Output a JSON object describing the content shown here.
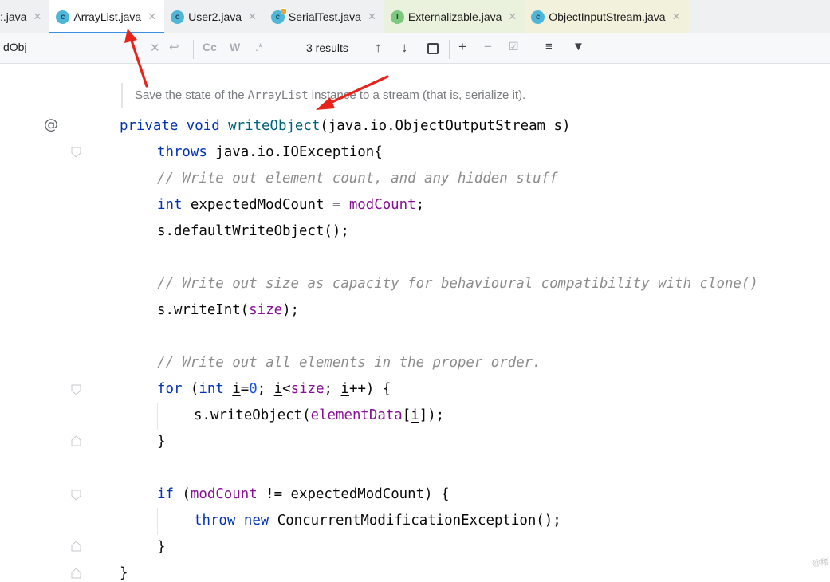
{
  "tabs": [
    {
      "label": ":.java",
      "icon": "none"
    },
    {
      "label": "ArrayList.java",
      "icon": "class-icon",
      "active": true
    },
    {
      "label": "User2.java",
      "icon": "class-icon"
    },
    {
      "label": "SerialTest.java",
      "icon": "class-runnable-icon"
    },
    {
      "label": "Externalizable.java",
      "icon": "interface-icon"
    },
    {
      "label": "ObjectInputStream.java",
      "icon": "class-icon"
    }
  ],
  "search": {
    "query": "dObj",
    "results": "3 results",
    "case_label": "Cc",
    "words_label": "W",
    "regex_label": ".*"
  },
  "doc_comment": {
    "before": "Save the state of the ",
    "code": "ArrayList",
    "after": " instance to a stream (that is, serialize it)."
  },
  "gutter": {
    "override_marker": "@"
  },
  "code": {
    "l1": {
      "kw1": "private",
      "kw2": "void",
      "method": "writeObject",
      "rest": "(java.io.ObjectOutputStream s)"
    },
    "l2": {
      "kw": "throws",
      "rest": " java.io.IOException{"
    },
    "l3": {
      "comment": "// Write out element count, and any hidden stuff"
    },
    "l4": {
      "kw": "int",
      "mid": " expectedModCount = ",
      "field": "modCount",
      "end": ";"
    },
    "l5": {
      "text": "s.defaultWriteObject();"
    },
    "l6": {
      "comment": "// Write out size as capacity for behavioural compatibility with clone()"
    },
    "l7": {
      "pre": "s.writeInt(",
      "field": "size",
      "end": ");"
    },
    "l8": {
      "comment": "// Write out all elements in the proper order."
    },
    "l9": {
      "kw1": "for",
      "p1": " (",
      "kw2": "int",
      "sp": " ",
      "v1": "i",
      "eq": "=",
      "num": "0",
      "semi": "; ",
      "v2": "i",
      "lt": "<",
      "field": "size",
      "semi2": "; ",
      "v3": "i",
      "end": "++) {"
    },
    "l10": {
      "pre": "s.writeObject(",
      "field": "elementData",
      "br": "[",
      "v": "i",
      "end": "]);"
    },
    "l11": {
      "text": "}"
    },
    "l12": {
      "kw": "if",
      "p1": " (",
      "field": "modCount",
      "end": " != expectedModCount) {"
    },
    "l13": {
      "kw1": "throw",
      "sp": " ",
      "kw2": "new",
      "rest": " ConcurrentModificationException();"
    },
    "l14": {
      "text": "}"
    },
    "l15": {
      "text": "}"
    }
  },
  "watermark": "@稀",
  "colors": {
    "keyword": "#0033b3",
    "method": "#00627a",
    "field": "#871094",
    "number": "#1750eb",
    "comment": "#8c8c8c",
    "arrow": "#e8231c",
    "tab_underline": "#3d8ee8"
  }
}
